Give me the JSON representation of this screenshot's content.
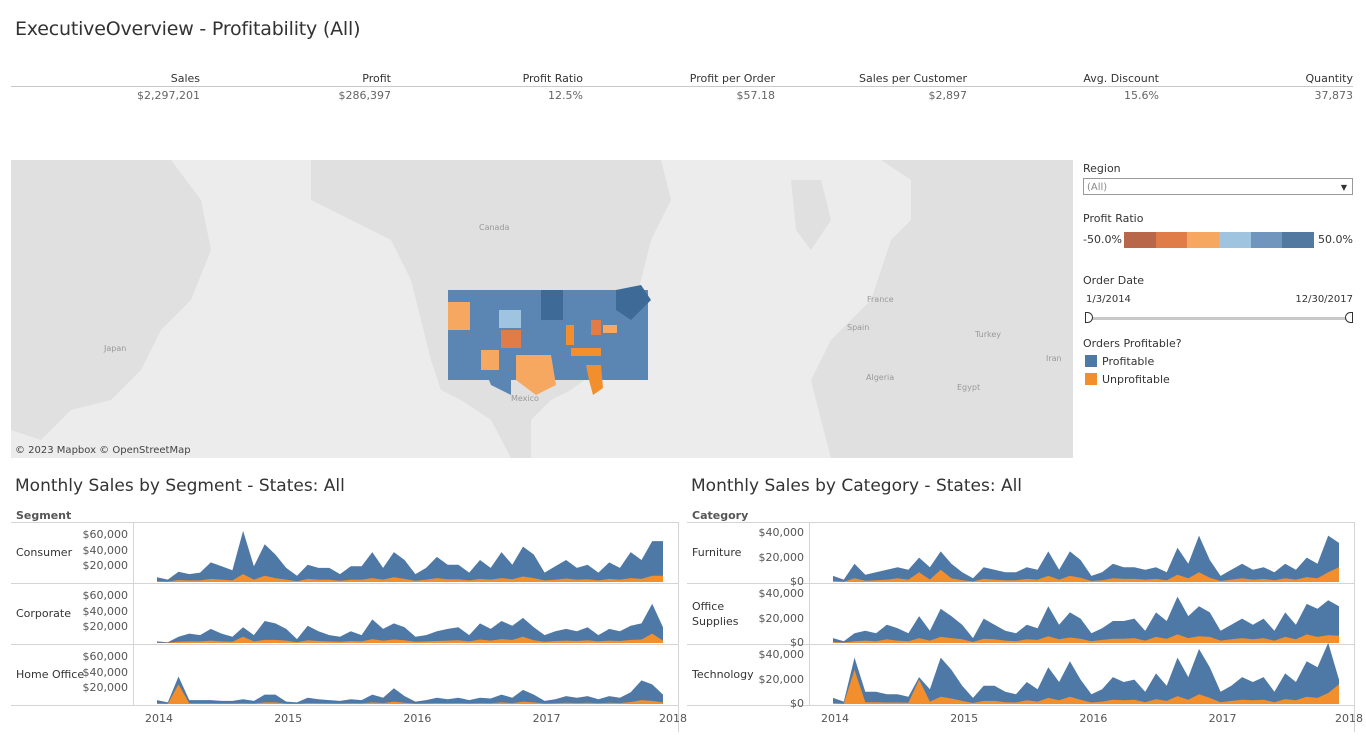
{
  "title": "ExecutiveOverview - Profitability (All)",
  "kpis": [
    {
      "label": "Sales",
      "value": "$2,297,201"
    },
    {
      "label": "Profit",
      "value": "$286,397"
    },
    {
      "label": "Profit Ratio",
      "value": "12.5%"
    },
    {
      "label": "Profit per Order",
      "value": "$57.18"
    },
    {
      "label": "Sales per Customer",
      "value": "$2,897"
    },
    {
      "label": "Avg. Discount",
      "value": "15.6%"
    },
    {
      "label": "Quantity",
      "value": "37,873"
    }
  ],
  "map": {
    "attribution": "© 2023 Mapbox  © OpenStreetMap",
    "labels": [
      "Canada",
      "Japan",
      "Mexico",
      "France",
      "Spain",
      "Algeria",
      "Egypt",
      "Turkey",
      "Iran"
    ],
    "colors": {
      "profitable": "#4e79a7",
      "unprofitable": "#f28e2b",
      "land": "#e0e0e0",
      "sea": "#ececec"
    }
  },
  "filters": {
    "region_title": "Region",
    "region_value": "(All)",
    "profit_ratio_title": "Profit Ratio",
    "profit_ratio_min": "-50.0%",
    "profit_ratio_max": "50.0%",
    "profit_ratio_colors": [
      "#b9674a",
      "#e07c48",
      "#f6a861",
      "#9fc4e0",
      "#7096bd",
      "#52799f"
    ],
    "order_date_title": "Order Date",
    "order_date_start": "1/3/2014",
    "order_date_end": "12/30/2017",
    "orders_profitable_title": "Orders Profitable?",
    "legend": [
      {
        "label": "Profitable",
        "color": "#4e79a7"
      },
      {
        "label": "Unprofitable",
        "color": "#f28e2b"
      }
    ]
  },
  "segment_panel": {
    "title": "Monthly Sales by Segment - States: All",
    "row_header": "Segment",
    "rows": [
      "Consumer",
      "Corporate",
      "Home Office"
    ],
    "ticks": [
      "$60,000",
      "$40,000",
      "$20,000"
    ],
    "years": [
      "2014",
      "2015",
      "2016",
      "2017",
      "2018"
    ]
  },
  "category_panel": {
    "title": "Monthly Sales by Category - States: All",
    "row_header": "Category",
    "rows": [
      "Furniture",
      "Office\nSupplies",
      "Technology"
    ],
    "ticks": [
      "$40,000",
      "$20,000",
      "$0"
    ],
    "years": [
      "2014",
      "2015",
      "2016",
      "2017",
      "2018"
    ]
  },
  "chart_data": [
    {
      "type": "area",
      "title": "Monthly Sales by Segment - States: All",
      "x_range": [
        "2014-01",
        "2017-12"
      ],
      "ylim": [
        0,
        70000
      ],
      "series": [
        {
          "name": "Consumer",
          "sales": [
            6000,
            3000,
            13000,
            10000,
            12000,
            25000,
            20000,
            15000,
            65000,
            20000,
            48000,
            35000,
            18000,
            8000,
            22000,
            18000,
            18000,
            10000,
            20000,
            20000,
            38000,
            18000,
            38000,
            28000,
            10000,
            18000,
            32000,
            22000,
            22000,
            12000,
            28000,
            18000,
            38000,
            22000,
            45000,
            35000,
            12000,
            20000,
            28000,
            18000,
            22000,
            12000,
            25000,
            18000,
            38000,
            28000,
            52000,
            52000
          ],
          "profit": [
            1000,
            500,
            2500,
            2000,
            2000,
            4000,
            3000,
            2000,
            10000,
            3000,
            8000,
            5000,
            3000,
            1000,
            4000,
            3000,
            3000,
            1500,
            3000,
            3000,
            5000,
            3000,
            6000,
            4000,
            1500,
            3000,
            5000,
            3500,
            3500,
            2000,
            4000,
            3000,
            5000,
            3500,
            7000,
            5000,
            2000,
            3000,
            4500,
            3000,
            3500,
            2000,
            4000,
            3000,
            5000,
            4000,
            8000,
            8000
          ]
        },
        {
          "name": "Corporate",
          "sales": [
            2000,
            1000,
            8000,
            12000,
            10000,
            18000,
            12000,
            8000,
            20000,
            10000,
            28000,
            25000,
            18000,
            5000,
            22000,
            15000,
            10000,
            8000,
            15000,
            10000,
            30000,
            18000,
            25000,
            20000,
            8000,
            10000,
            15000,
            18000,
            20000,
            10000,
            25000,
            18000,
            28000,
            22000,
            32000,
            20000,
            10000,
            15000,
            18000,
            15000,
            20000,
            10000,
            18000,
            15000,
            22000,
            25000,
            50000,
            20000
          ],
          "profit": [
            300,
            200,
            1500,
            2000,
            2000,
            3000,
            2000,
            1500,
            8000,
            2000,
            4000,
            4000,
            3000,
            1000,
            3500,
            2500,
            2000,
            1500,
            2500,
            2000,
            5000,
            3000,
            4500,
            3500,
            1500,
            2000,
            2500,
            3000,
            3500,
            2000,
            4500,
            3000,
            5000,
            4000,
            8000,
            3500,
            1500,
            2500,
            3000,
            2500,
            3500,
            2000,
            3000,
            2500,
            4000,
            4500,
            12000,
            3000
          ]
        },
        {
          "name": "Home Office",
          "sales": [
            5000,
            2000,
            35000,
            5000,
            5000,
            5000,
            4000,
            4000,
            6000,
            4000,
            12000,
            12000,
            3000,
            2000,
            8000,
            6000,
            5000,
            4000,
            6000,
            5000,
            12000,
            8000,
            20000,
            10000,
            3000,
            5000,
            8000,
            6000,
            8000,
            5000,
            8000,
            7000,
            12000,
            8000,
            18000,
            12000,
            4000,
            6000,
            10000,
            8000,
            10000,
            6000,
            10000,
            8000,
            15000,
            30000,
            25000,
            12000
          ],
          "profit": [
            800,
            300,
            25000,
            800,
            800,
            800,
            600,
            600,
            1000,
            600,
            2000,
            2000,
            500,
            300,
            1200,
            1000,
            800,
            600,
            1000,
            800,
            2000,
            1200,
            3000,
            1500,
            500,
            800,
            1200,
            1000,
            1200,
            800,
            1200,
            1000,
            2000,
            1200,
            3000,
            2000,
            600,
            1000,
            1500,
            1200,
            1500,
            1000,
            1500,
            1200,
            2500,
            5000,
            4000,
            2000
          ]
        }
      ]
    },
    {
      "type": "area",
      "title": "Monthly Sales by Category - States: All",
      "x_range": [
        "2014-01",
        "2017-12"
      ],
      "ylim": [
        0,
        45000
      ],
      "series": [
        {
          "name": "Furniture",
          "sales": [
            5000,
            2000,
            15000,
            6000,
            8000,
            10000,
            12000,
            10000,
            20000,
            12000,
            25000,
            15000,
            8000,
            3000,
            12000,
            10000,
            8000,
            8000,
            12000,
            10000,
            25000,
            10000,
            25000,
            18000,
            5000,
            8000,
            15000,
            12000,
            12000,
            10000,
            12000,
            8000,
            28000,
            15000,
            38000,
            18000,
            5000,
            10000,
            15000,
            10000,
            12000,
            8000,
            15000,
            10000,
            20000,
            15000,
            38000,
            32000
          ],
          "profit": [
            1000,
            300,
            3000,
            1000,
            1500,
            2000,
            3000,
            2000,
            8000,
            2000,
            10000,
            3000,
            1500,
            500,
            2500,
            2000,
            1500,
            1500,
            2500,
            2000,
            5000,
            2000,
            5000,
            3500,
            800,
            1500,
            3000,
            2500,
            2500,
            2000,
            2500,
            1500,
            6000,
            3000,
            8000,
            3500,
            800,
            2000,
            3000,
            2000,
            2500,
            1500,
            3000,
            2000,
            4000,
            3000,
            8000,
            12000
          ]
        },
        {
          "name": "Office Supplies",
          "sales": [
            4000,
            1500,
            8000,
            10000,
            8000,
            15000,
            12000,
            8000,
            22000,
            10000,
            28000,
            22000,
            15000,
            4000,
            20000,
            15000,
            10000,
            8000,
            15000,
            12000,
            30000,
            15000,
            25000,
            20000,
            8000,
            12000,
            18000,
            18000,
            20000,
            10000,
            25000,
            18000,
            38000,
            22000,
            30000,
            25000,
            10000,
            15000,
            20000,
            15000,
            20000,
            10000,
            25000,
            15000,
            32000,
            28000,
            35000,
            30000
          ],
          "profit": [
            800,
            300,
            1500,
            2000,
            1500,
            3000,
            2000,
            1500,
            4000,
            2000,
            5000,
            4000,
            3000,
            800,
            3500,
            3000,
            2000,
            1500,
            3000,
            2500,
            5500,
            3000,
            4500,
            3500,
            1500,
            2500,
            3500,
            3500,
            4000,
            2000,
            5000,
            3500,
            7000,
            4000,
            5500,
            5000,
            2000,
            3000,
            4000,
            3000,
            4000,
            2000,
            5000,
            3000,
            7000,
            5000,
            6500,
            6000
          ]
        },
        {
          "name": "Technology",
          "sales": [
            5000,
            2000,
            38000,
            10000,
            10000,
            8000,
            8000,
            6000,
            22000,
            12000,
            38000,
            28000,
            15000,
            5000,
            15000,
            15000,
            10000,
            8000,
            18000,
            12000,
            30000,
            18000,
            35000,
            20000,
            8000,
            12000,
            22000,
            18000,
            20000,
            10000,
            25000,
            15000,
            38000,
            22000,
            45000,
            30000,
            10000,
            15000,
            22000,
            18000,
            22000,
            10000,
            25000,
            18000,
            35000,
            30000,
            50000,
            20000
          ],
          "profit": [
            800,
            300,
            28000,
            1500,
            1500,
            1200,
            1200,
            1000,
            20000,
            2000,
            6000,
            4500,
            2500,
            800,
            2500,
            2500,
            1500,
            1200,
            3000,
            2000,
            5000,
            3000,
            6000,
            3500,
            1200,
            2000,
            3500,
            3000,
            3500,
            1500,
            4000,
            2500,
            6500,
            3500,
            8000,
            5000,
            1500,
            2500,
            3500,
            3000,
            3500,
            1500,
            4000,
            3000,
            6000,
            5000,
            9000,
            16000
          ]
        }
      ]
    }
  ]
}
